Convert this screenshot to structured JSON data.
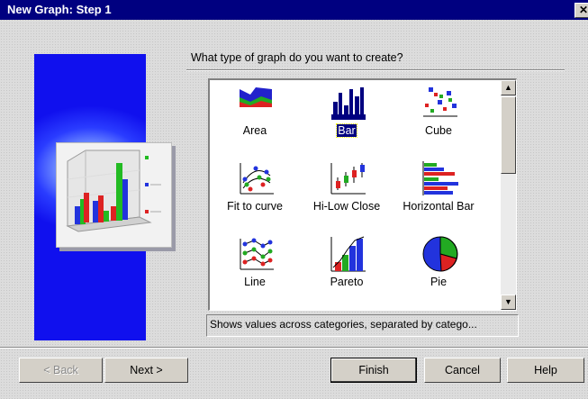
{
  "window": {
    "title": "New Graph: Step 1",
    "close_glyph": "✕"
  },
  "prompt": {
    "question": "What type of graph do you want to create?"
  },
  "graph_types": [
    {
      "label": "Area",
      "icon": "area-chart-icon",
      "selected": false
    },
    {
      "label": "Bar",
      "icon": "bar-chart-icon",
      "selected": true
    },
    {
      "label": "Cube",
      "icon": "cube-chart-icon",
      "selected": false
    },
    {
      "label": "Fit to curve",
      "icon": "fit-curve-icon",
      "selected": false
    },
    {
      "label": "Hi-Low Close",
      "icon": "hi-low-close-icon",
      "selected": false
    },
    {
      "label": "Horizontal Bar",
      "icon": "horizontal-bar-icon",
      "selected": false
    },
    {
      "label": "Line",
      "icon": "line-chart-icon",
      "selected": false
    },
    {
      "label": "Pareto",
      "icon": "pareto-chart-icon",
      "selected": false
    },
    {
      "label": "Pie",
      "icon": "pie-chart-icon",
      "selected": false
    }
  ],
  "scrollbar": {
    "up_glyph": "▲",
    "down_glyph": "▼"
  },
  "status": {
    "description": "Shows values across categories, separated by catego..."
  },
  "buttons": {
    "back": "< Back",
    "next": "Next >",
    "finish": "Finish",
    "cancel": "Cancel",
    "help": "Help"
  },
  "colors": {
    "title_bar": "#000080",
    "selection": "#000080",
    "banner": "#1a1aff"
  }
}
